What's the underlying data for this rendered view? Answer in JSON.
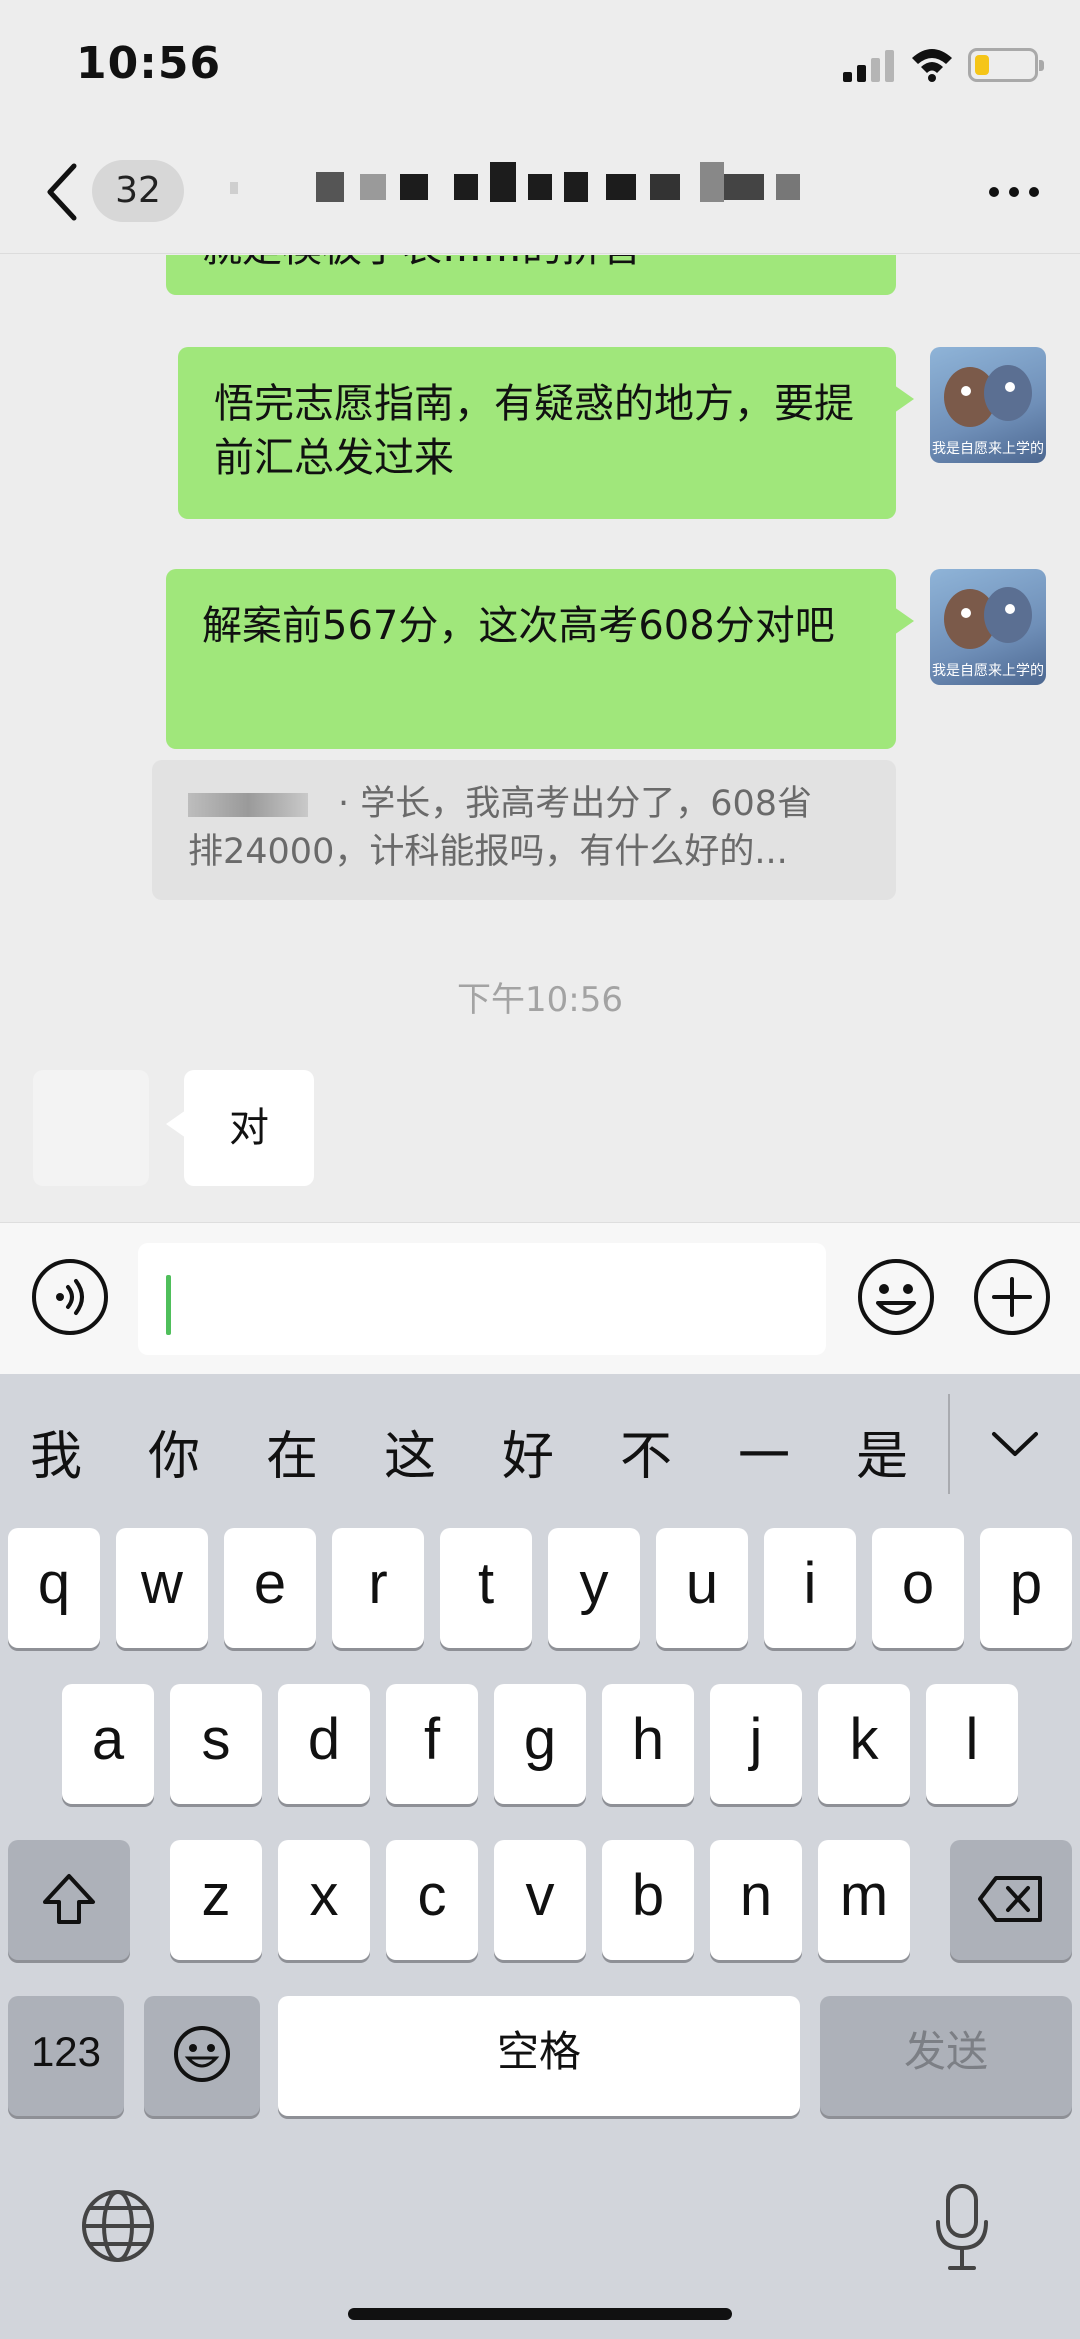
{
  "status_bar": {
    "time": "10:56",
    "battery_level": 0.25,
    "battery_color": "#f5c518"
  },
  "nav": {
    "unread_count": "32"
  },
  "messages": [
    {
      "from": "me",
      "text": "就是模板了表……的拼音"
    },
    {
      "from": "me",
      "text": "悟完志愿指南，有疑惑的地方，要提前汇总发过来"
    },
    {
      "from": "me",
      "text": "解案前567分，这次高考608分对吧"
    }
  ],
  "quote": {
    "line1": "· 学长，我高考出分了，608省",
    "line2": "排24000，计科能报吗，有什么好的..."
  },
  "timestamp": "下午10:56",
  "reply": {
    "text": "对"
  },
  "avatar_caption": "我是自愿来上学的",
  "keyboard": {
    "candidates": [
      "我",
      "你",
      "在",
      "这",
      "好",
      "不",
      "一",
      "是"
    ],
    "row1": [
      "q",
      "w",
      "e",
      "r",
      "t",
      "y",
      "u",
      "i",
      "o",
      "p"
    ],
    "row2": [
      "a",
      "s",
      "d",
      "f",
      "g",
      "h",
      "j",
      "k",
      "l"
    ],
    "row3": [
      "z",
      "x",
      "c",
      "v",
      "b",
      "n",
      "m"
    ],
    "numbers_label": "123",
    "space_label": "空格",
    "send_label": "发送"
  },
  "colors": {
    "my_bubble": "#a0e77b",
    "accent": "#4fbf5b"
  }
}
